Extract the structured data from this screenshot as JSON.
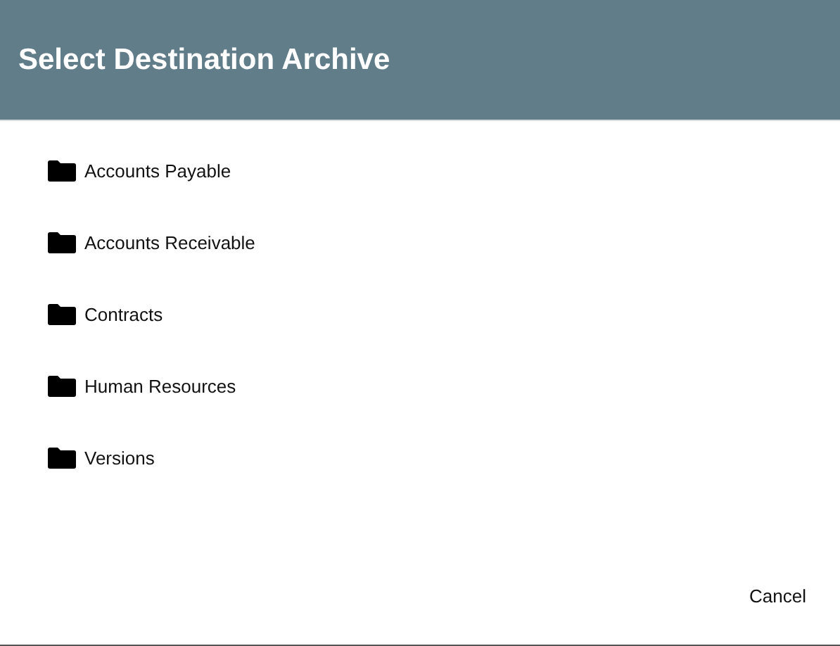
{
  "dialog": {
    "title": "Select Destination Archive"
  },
  "folders": [
    {
      "label": "Accounts Payable"
    },
    {
      "label": "Accounts Receivable"
    },
    {
      "label": "Contracts"
    },
    {
      "label": "Human Resources"
    },
    {
      "label": "Versions"
    }
  ],
  "buttons": [
    "Cancel"
  ]
}
